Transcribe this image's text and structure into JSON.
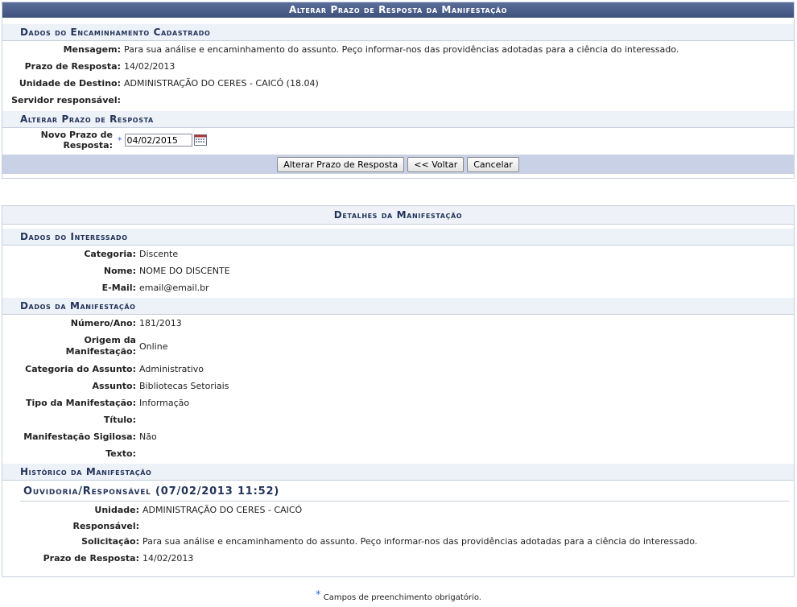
{
  "top": {
    "caption": "Alterar Prazo de Resposta da Manifestação",
    "encaminhamento_header": "Dados do Encaminhamento Cadastrado",
    "mensagem_label": "Mensagem:",
    "mensagem": "Para sua análise e encaminhamento do assunto. Peço informar-nos das providências adotadas para a ciência do interessado.",
    "prazo_label": "Prazo de Resposta:",
    "prazo": "14/02/2013",
    "unidade_label": "Unidade de Destino:",
    "unidade": "ADMINISTRAÇÃO DO CERES - CAICÓ (18.04)",
    "servidor_label": "Servidor responsável:",
    "alterar_header": "Alterar Prazo de Resposta",
    "novo_prazo_label": "Novo Prazo de Resposta:",
    "novo_prazo_value": "04/02/2015",
    "btn_alterar": "Alterar Prazo de Resposta",
    "btn_voltar": "<< Voltar",
    "btn_cancelar": "Cancelar"
  },
  "detalhes": {
    "caption": "Detalhes da Manifestação",
    "interessado_header": "Dados do Interessado",
    "categoria_label": "Categoria:",
    "categoria": "Discente",
    "nome_label": "Nome:",
    "nome": "NOME DO DISCENTE",
    "email_label": "E-Mail:",
    "email": "email@email.br",
    "manifestacao_header": "Dados da Manifestação",
    "numero_label": "Número/Ano:",
    "numero": "181/2013",
    "origem_label": "Origem da Manifestação:",
    "origem": "Online",
    "cat_assunto_label": "Categoria do Assunto:",
    "cat_assunto": "Administrativo",
    "assunto_label": "Assunto:",
    "assunto": "Bibliotecas Setoriais",
    "tipo_label": "Tipo da Manifestação:",
    "tipo": "Informação",
    "titulo_label": "Título:",
    "sigilosa_label": "Manifestação Sigilosa:",
    "sigilosa": "Não",
    "texto_label": "Texto:",
    "historico_header": "Histórico da Manifestação",
    "hist_entry_title": "Ouvidoria/Responsável (07/02/2013 11:52)",
    "hist_unidade_label": "Unidade:",
    "hist_unidade": "ADMINISTRAÇÃO DO CERES - CAICÓ",
    "hist_responsavel_label": "Responsável:",
    "hist_solicitacao_label": "Solicitação:",
    "hist_solicitacao": "Para sua análise e encaminhamento do assunto. Peço informar-nos das providências adotadas para a ciência do interessado.",
    "hist_prazo_label": "Prazo de Resposta:",
    "hist_prazo": "14/02/2013"
  },
  "footer": {
    "required_star": "*",
    "required_note": "Campos de preenchimento obrigatório."
  },
  "icons": {
    "calendar": "calendar-icon",
    "required": "required-star-icon"
  },
  "colors": {
    "caption_bg": "#46598a",
    "subheader_bg": "#edf1f8",
    "button_bar": "#c8d1e6",
    "heading_text": "#23345a",
    "required_star": "#3a6cd6"
  }
}
